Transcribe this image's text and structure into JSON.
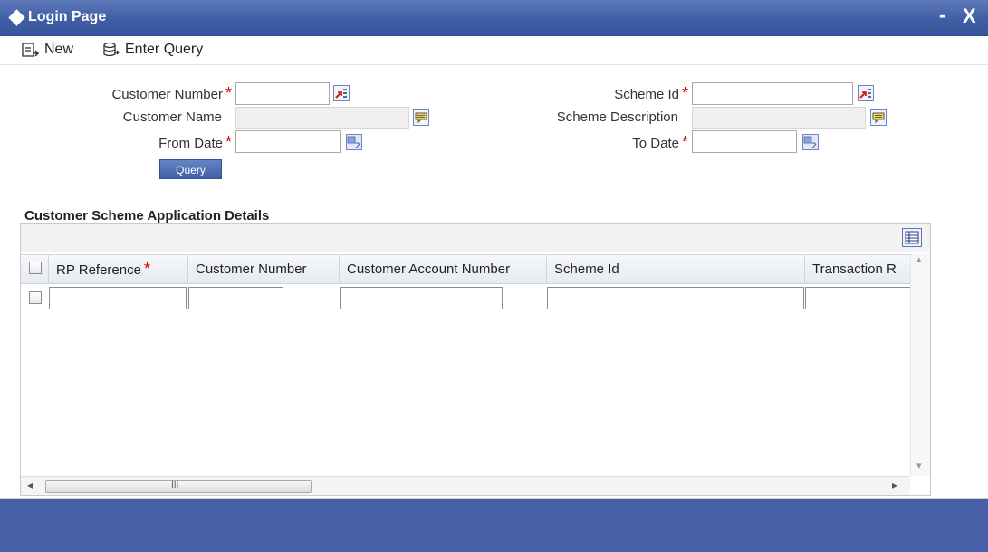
{
  "window": {
    "title": "Login Page",
    "minimize": "-",
    "close": "X"
  },
  "toolbar": {
    "new_label": "New",
    "enter_query_label": "Enter Query"
  },
  "form": {
    "customer_number_label": "Customer Number",
    "customer_name_label": "Customer Name",
    "from_date_label": "From Date",
    "scheme_id_label": "Scheme Id",
    "scheme_description_label": "Scheme Description",
    "to_date_label": "To Date",
    "required_marker": "*",
    "query_button": "Query",
    "customer_number_value": "",
    "customer_name_value": "",
    "from_date_value": "",
    "scheme_id_value": "",
    "scheme_description_value": "",
    "to_date_value": ""
  },
  "grid": {
    "section_title": "Customer Scheme Application Details",
    "columns": [
      "RP Reference",
      "Customer Number",
      "Customer Account Number",
      "Scheme Id",
      "Transaction R"
    ],
    "rows": [
      [
        "",
        "",
        "",
        "",
        ""
      ]
    ]
  },
  "scrollbar": {
    "thumb_grip": "III",
    "left_arrow": "◂",
    "right_arrow": "▸",
    "up_arrow": "▴",
    "down_arrow": "▾"
  },
  "colors": {
    "titlebar": "#3f5ea5",
    "footer": "#4661a8",
    "required": "#d40000",
    "query_button": "#4a68ad"
  }
}
